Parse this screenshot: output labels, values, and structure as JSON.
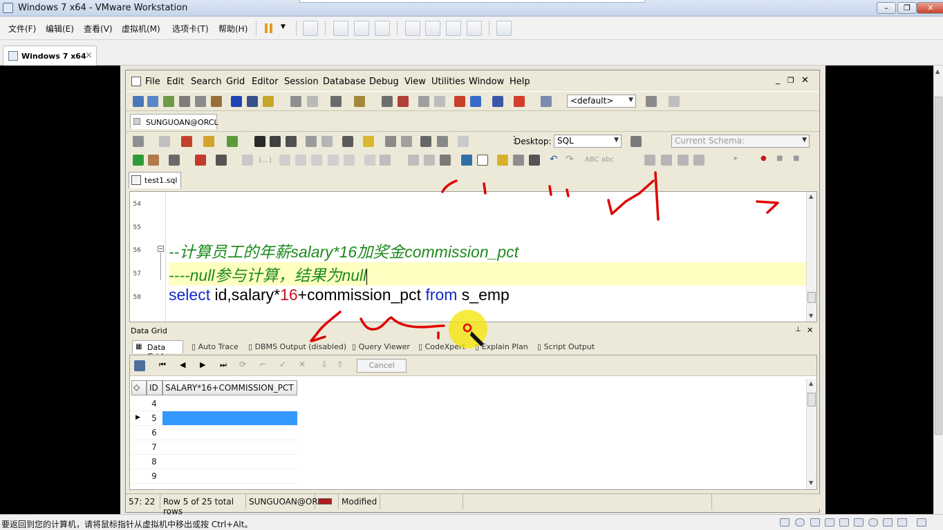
{
  "host": {
    "title": "Windows 7 x64 - VMware Workstation",
    "menu": [
      "文件(F)",
      "编辑(E)",
      "查看(V)",
      "虚拟机(M)",
      "选项卡(T)",
      "帮助(H)"
    ],
    "tab_label": "Windows 7 x64",
    "tab_close": "×",
    "status_text": "要返回到您的计算机，请将鼠标指针从虚拟机中移出或按 Ctrl+Alt。"
  },
  "app": {
    "menu": [
      "File",
      "Edit",
      "Search",
      "Grid",
      "Editor",
      "Session",
      "Database",
      "Debug",
      "View",
      "Utilities",
      "Window",
      "Help"
    ],
    "default_combo": "<default>",
    "connection_tab": "SUNGUOAN@ORCL",
    "desktop_label": "Desktop:",
    "desktop_value": "SQL",
    "schema_label": "Current Schema:",
    "abc1": "ABC",
    "abc2": "abc",
    "file_tab": "test1.sql"
  },
  "editor": {
    "line_numbers": [
      "54",
      "55",
      "56",
      "57",
      "58"
    ],
    "line56": "--计算员工的年薪salary*16加奖金commission_pct",
    "line57": "----null参与计算，结果为null",
    "line58_kw1": "select",
    "line58_a": " id,salary*",
    "line58_num": "16",
    "line58_b": "+commission_pct ",
    "line58_kw2": "from",
    "line58_c": " s_emp"
  },
  "grid": {
    "panel_title": "Data Grid",
    "tabs": [
      "Data Grid",
      "Auto Trace",
      "DBMS Output (disabled)",
      "Query Viewer",
      "CodeXpert",
      "Explain Plan",
      "Script Output"
    ],
    "cancel": "Cancel",
    "columns": [
      "ID",
      "SALARY*16+COMMISSION_PCT"
    ],
    "rows": [
      {
        "id": "4",
        "value": ""
      },
      {
        "id": "5",
        "value": ""
      },
      {
        "id": "6",
        "value": ""
      },
      {
        "id": "7",
        "value": ""
      },
      {
        "id": "8",
        "value": ""
      },
      {
        "id": "9",
        "value": ""
      }
    ],
    "selected_row_id": "5"
  },
  "status": {
    "position": "57: 22",
    "rows_info": "Row 5 of 25 total rows",
    "connection": "SUNGUOAN@ORCL",
    "modified": "Modified"
  },
  "colors": {
    "comment": "#1d8a1d",
    "keyword": "#1428c8",
    "number": "#c8141e",
    "selection": "#3399ff",
    "annotation": "#e00000",
    "cursor_highlight": "#f5e400"
  }
}
